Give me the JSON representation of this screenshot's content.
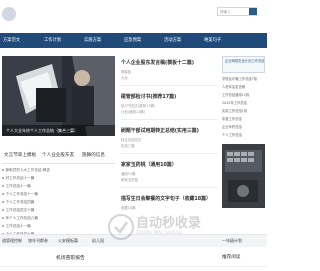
{
  "header": {
    "search": {
      "placeholder": "请输入"
    }
  },
  "nav": {
    "items": [
      {
        "label": "方案范文"
      },
      {
        "label": "工作计划"
      },
      {
        "label": "实施方案"
      },
      {
        "label": "应急预案"
      },
      {
        "label": "活动方案"
      },
      {
        "label": "唯美句子"
      }
    ]
  },
  "slider": {
    "caption": "个人大全年终个人工作总结（集合三篇）"
  },
  "left_tabs": {
    "items": [
      {
        "label": "文言节单上模板"
      },
      {
        "label": "个人业业股东友"
      },
      {
        "label": "施舞的信息"
      }
    ]
  },
  "left_list": {
    "items": [
      {
        "label": "新晰员的人大工作总结 精选"
      },
      {
        "label": "好工作总结十一篇"
      },
      {
        "label": "工作总结十一篇"
      },
      {
        "label": "个人工作总结十一篇"
      },
      {
        "label": "个人工作总结四篇"
      },
      {
        "label": "工作总结范文十篇"
      },
      {
        "label": "年个人工作总结六篇"
      },
      {
        "label": "工作总结十一篇"
      },
      {
        "label": "个人工作总结十篇"
      }
    ]
  },
  "mid_cards": [
    {
      "title": "个人企业股东发言稿(模板十二篇)",
      "lines": [
        "篇模板",
        "大全"
      ]
    },
    {
      "title": "碰管部检讨书(推荐17篇)",
      "lines": [
        "检讨书范文(推荐17篇)",
        "计划(通用13篇)"
      ]
    },
    {
      "title": "刷题干部试用期转正总结(实用三篇)",
      "lines": [
        "转正总结范文",
        "实用三篇"
      ]
    },
    {
      "title": "家家玉药桃（通用10篇）",
      "lines": [
        "通用10篇",
        "家家玉药桃"
      ]
    },
    {
      "title": "描写生日会聚餐的文字句子（收藏18篇）",
      "lines": [
        "收藏18篇"
      ]
    }
  ],
  "right_col": {
    "banner": "企业网络安全计划工作总结",
    "items": [
      {
        "label": "学校反诈骗工作总结7篇"
      },
      {
        "label": "人资年会发言稿"
      },
      {
        "label": "工作总结通用12篇"
      },
      {
        "label": "2025年工作总结"
      },
      {
        "label": "实用工作总结1篇"
      },
      {
        "label": "年度工作总结"
      },
      {
        "label": "企业年终总结"
      },
      {
        "label": "个人工作总结"
      }
    ]
  },
  "section_bar": {
    "links": [
      {
        "label": "道管理控制"
      },
      {
        "label": "旅年刊都参"
      },
      {
        "label": "公安模板篇"
      },
      {
        "label": "幼儿园"
      },
      {
        "label": "一年级计划"
      }
    ]
  },
  "bottom": {
    "left_title": "机场苗职报告",
    "right_title": "推荐阅读"
  },
  "watermark": {
    "title": "自动秒收录",
    "subtitle": "ZIDONG MIAO SHOULU"
  }
}
